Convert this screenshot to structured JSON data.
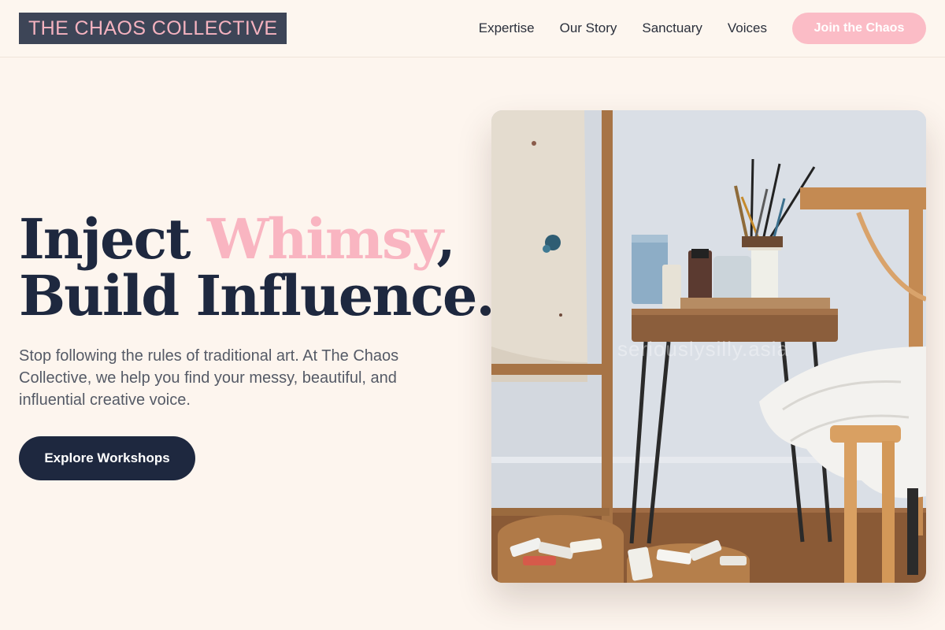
{
  "header": {
    "logo": "THE CHAOS COLLECTIVE",
    "nav": [
      "Expertise",
      "Our Story",
      "Sanctuary",
      "Voices"
    ],
    "cta_label": "Join the Chaos"
  },
  "hero": {
    "headline_part1": "Inject ",
    "headline_accent": "Whimsy",
    "headline_part2": ",",
    "headline_line2": "Build Influence.",
    "subtext": "Stop following the rules of traditional art. At The Chaos Collective, we help you find your messy, beautiful, and influential creative voice.",
    "cta_label": "Explore Workshops",
    "image_watermark": "seriouslysilly.asia"
  },
  "colors": {
    "background": "#fdf5ee",
    "navy": "#1e283f",
    "pink_accent": "#f9b5c1",
    "logo_bg": "#3d4557"
  }
}
